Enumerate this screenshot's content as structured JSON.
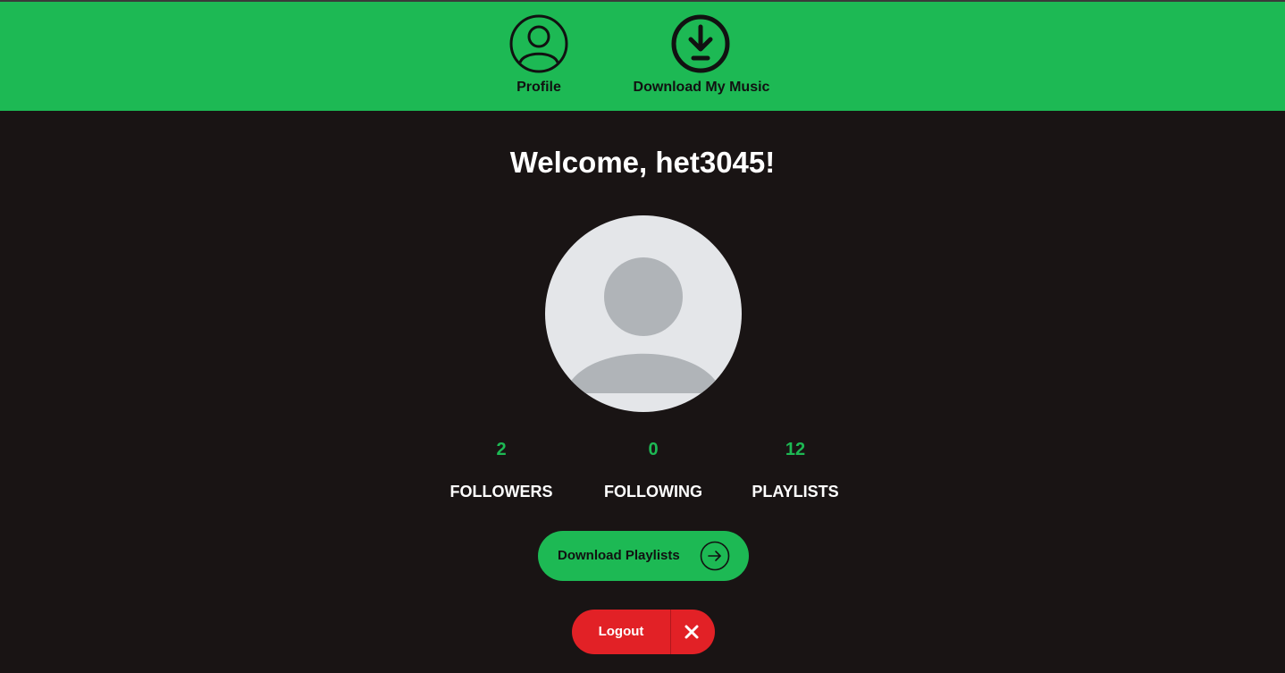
{
  "nav": {
    "items": [
      {
        "label": "Profile",
        "icon": "user-circle-icon"
      },
      {
        "label": "Download My Music",
        "icon": "download-circle-icon"
      }
    ]
  },
  "main": {
    "welcome": "Welcome, het3045!",
    "avatar_icon": "default-avatar",
    "stats": [
      {
        "value": "2",
        "label": "FOLLOWERS"
      },
      {
        "value": "0",
        "label": "FOLLOWING"
      },
      {
        "value": "12",
        "label": "PLAYLISTS"
      }
    ],
    "download_button": {
      "label": "Download Playlists",
      "icon": "arrow-right-icon"
    },
    "logout_button": {
      "label": "Logout",
      "icon": "close-icon"
    }
  },
  "colors": {
    "brand_green": "#1db954",
    "background": "#191414",
    "logout_red": "#e22126"
  }
}
